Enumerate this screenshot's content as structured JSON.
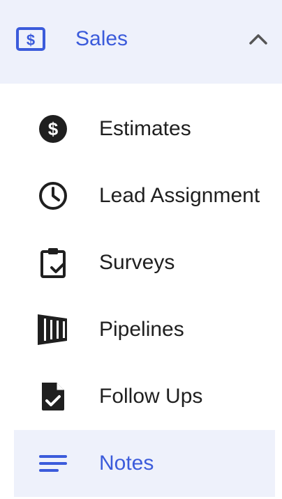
{
  "section": {
    "label": "Sales",
    "icon": "dollar-card-icon",
    "expanded": true,
    "collapse_icon": "chevron-up-icon"
  },
  "items": [
    {
      "label": "Estimates",
      "icon": "dollar-circle-icon"
    },
    {
      "label": "Lead Assignment",
      "icon": "clock-icon"
    },
    {
      "label": "Surveys",
      "icon": "clipboard-check-icon"
    },
    {
      "label": "Pipelines",
      "icon": "pipeline-funnel-icon"
    },
    {
      "label": "Follow Ups",
      "icon": "document-check-icon"
    },
    {
      "label": "Notes",
      "icon": "notes-lines-icon",
      "active": true
    }
  ],
  "colors": {
    "accent": "#3b5bdb",
    "active_background": "#eef1fb",
    "text": "#1f1f1f",
    "icon": "#1f1f1f"
  }
}
